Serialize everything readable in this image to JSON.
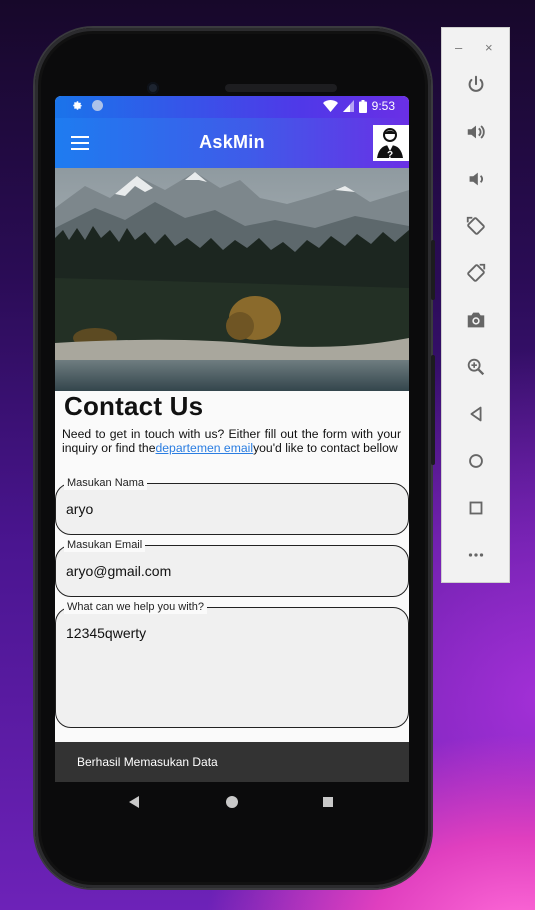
{
  "status_bar": {
    "time": "9:53",
    "left_icons": [
      "gear-icon",
      "circle-icon"
    ],
    "right_icons": [
      "wifi-icon",
      "signal-icon",
      "battery-icon"
    ]
  },
  "app_bar": {
    "title": "AskMin",
    "menu_icon": "hamburger-icon",
    "avatar_icon": "user-question-icon"
  },
  "page": {
    "heading": "Contact Us",
    "intro_before": "Need to get in touch with us? Either fill out the form with your inquiry or find the",
    "intro_link": "departemen email",
    "intro_after": "you'd like to contact bellow"
  },
  "form": {
    "name_label": "Masukan Nama",
    "name_value": "aryo",
    "email_label": "Masukan Email",
    "email_value": "aryo@gmail.com",
    "message_label": "What can we help you with?",
    "message_value": "12345qwerty"
  },
  "snackbar": {
    "text": "Berhasil Memasukan Data"
  },
  "emulator_panel": {
    "minimize": "–",
    "close": "×",
    "tools": [
      "power-icon",
      "volume-up-icon",
      "volume-down-icon",
      "rotate-left-icon",
      "rotate-right-icon",
      "camera-icon",
      "zoom-icon",
      "back-icon",
      "home-icon",
      "overview-icon",
      "more-icon"
    ]
  },
  "colors": {
    "appbar_start": "#1e7cf0",
    "appbar_end": "#6a2fe6",
    "link": "#2a7de1",
    "snackbar": "#333333"
  }
}
